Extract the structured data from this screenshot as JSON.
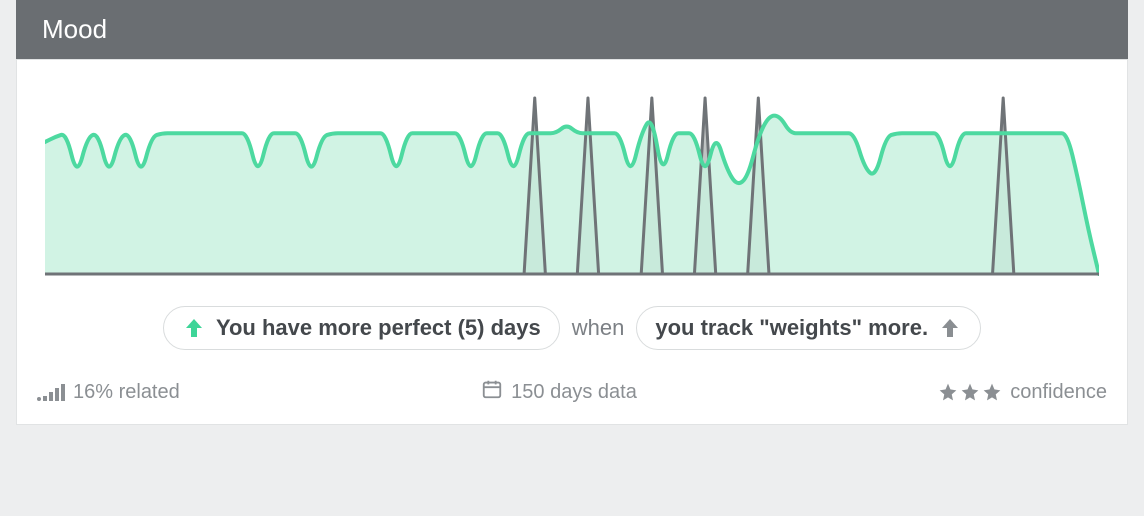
{
  "header": {
    "title": "Mood"
  },
  "insight": {
    "left_pill": "You have more perfect (5) days",
    "connector": "when",
    "right_pill": "you track \"weights\" more."
  },
  "footer": {
    "related": "16% related",
    "days": "150 days data",
    "confidence": "confidence",
    "confidence_stars": 3
  },
  "colors": {
    "green": "#4dd9a0",
    "green_fill": "#c9f1df",
    "gray": "#6f7377",
    "gray_fill": "#b9bcbd",
    "arrow_gray": "#888c90"
  },
  "chart_data": {
    "type": "area",
    "title": "Mood",
    "xlabel": "",
    "ylabel": "",
    "x": [
      0,
      1,
      2,
      3,
      4,
      5,
      6,
      7,
      8,
      9,
      10,
      11,
      12,
      13,
      14,
      15,
      16,
      17,
      18,
      19,
      20,
      21,
      22,
      23,
      24,
      25,
      26,
      27,
      28,
      29,
      30,
      31,
      32,
      33,
      34,
      35,
      36,
      37,
      38,
      39,
      40,
      41,
      42,
      43,
      44,
      45,
      46,
      47,
      48,
      49,
      50,
      51,
      52,
      53,
      54,
      55,
      56,
      57,
      58,
      59,
      60,
      61,
      62,
      63,
      64,
      65,
      66,
      67,
      68,
      69,
      70,
      71,
      72,
      73,
      74,
      75,
      76,
      77,
      78,
      79,
      80,
      81,
      82,
      83,
      84,
      85,
      86,
      87,
      88,
      89,
      90,
      91,
      92,
      93,
      94,
      95,
      96,
      97,
      98,
      99
    ],
    "ylim": [
      0,
      1
    ],
    "series": [
      {
        "name": "mood",
        "color": "#4dd9a0",
        "values": [
          0.75,
          0.78,
          0.8,
          0.55,
          0.78,
          0.8,
          0.55,
          0.78,
          0.8,
          0.55,
          0.78,
          0.8,
          0.8,
          0.8,
          0.8,
          0.8,
          0.8,
          0.8,
          0.8,
          0.8,
          0.55,
          0.8,
          0.8,
          0.8,
          0.8,
          0.55,
          0.78,
          0.8,
          0.8,
          0.8,
          0.8,
          0.8,
          0.8,
          0.55,
          0.8,
          0.8,
          0.8,
          0.8,
          0.8,
          0.8,
          0.55,
          0.8,
          0.8,
          0.8,
          0.55,
          0.8,
          0.8,
          0.8,
          0.8,
          0.85,
          0.8,
          0.8,
          0.8,
          0.8,
          0.8,
          0.55,
          0.8,
          0.9,
          0.55,
          0.8,
          0.8,
          0.8,
          0.55,
          0.8,
          0.6,
          0.5,
          0.55,
          0.78,
          0.9,
          0.9,
          0.8,
          0.8,
          0.8,
          0.8,
          0.8,
          0.8,
          0.8,
          0.6,
          0.55,
          0.78,
          0.8,
          0.8,
          0.8,
          0.8,
          0.8,
          0.55,
          0.8,
          0.8,
          0.8,
          0.8,
          0.8,
          0.8,
          0.8,
          0.8,
          0.8,
          0.8,
          0.8,
          0.55,
          0.25,
          0.0
        ]
      },
      {
        "name": "weights_tracked",
        "color": "#6f7377",
        "values": [
          0,
          0,
          0,
          0,
          0,
          0,
          0,
          0,
          0,
          0,
          0,
          0,
          0,
          0,
          0,
          0,
          0,
          0,
          0,
          0,
          0,
          0,
          0,
          0,
          0,
          0,
          0,
          0,
          0,
          0,
          0,
          0,
          0,
          0,
          0,
          0,
          0,
          0,
          0,
          0,
          0,
          0,
          0,
          0,
          0,
          0,
          1,
          0,
          0,
          0,
          0,
          1,
          0,
          0,
          0,
          0,
          0,
          1,
          0,
          0,
          0,
          0,
          1,
          0,
          0,
          0,
          0,
          1,
          0,
          0,
          0,
          0,
          0,
          0,
          0,
          0,
          0,
          0,
          0,
          0,
          0,
          0,
          0,
          0,
          0,
          0,
          0,
          0,
          0,
          0,
          1,
          0,
          0,
          0,
          0,
          0,
          0,
          0,
          0,
          0
        ]
      }
    ]
  }
}
